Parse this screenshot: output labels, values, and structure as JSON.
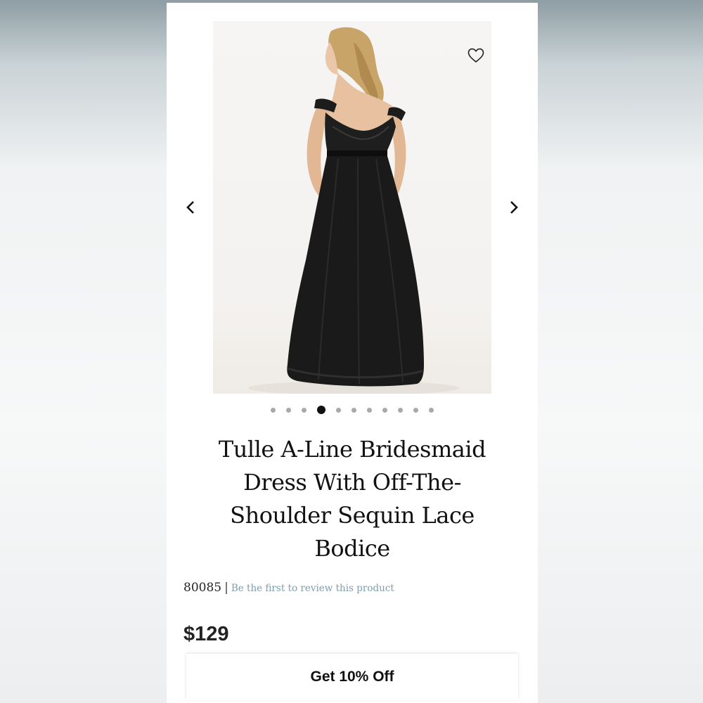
{
  "gallery": {
    "image_description_icon": "dress-back-view-photo",
    "favorite_icon": "heart-outline-icon",
    "prev_icon": "chevron-left-icon",
    "next_icon": "chevron-right-icon",
    "slide_count": 11,
    "active_slide": 4
  },
  "product": {
    "title": "Tulle A-Line Bridesmaid Dress With Off-The-Shoulder Sequin Lace Bodice",
    "sku": "80085",
    "separator": "|",
    "review_link": "Be the first to review this product",
    "price": "$129"
  },
  "cta": {
    "label": "Get 10% Off"
  },
  "colors": {
    "text": "#111111",
    "link": "#7d9db0",
    "dot_inactive": "#a9a9a9",
    "dot_active": "#111111"
  }
}
